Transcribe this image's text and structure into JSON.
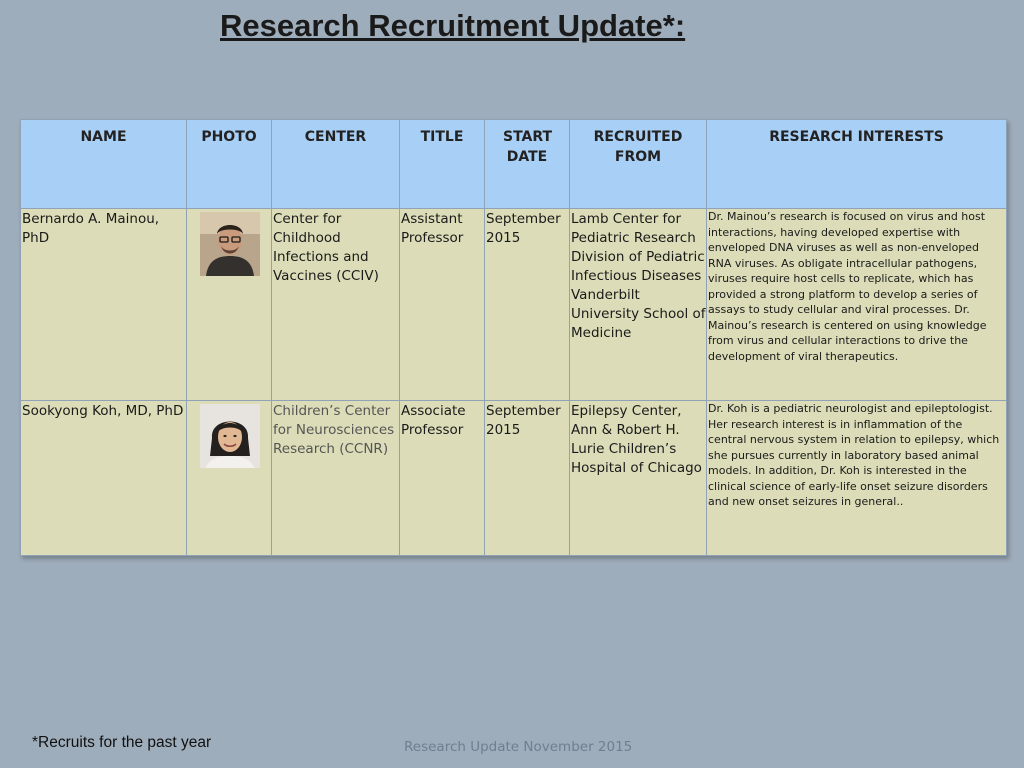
{
  "page_title": "Research Recruitment Update*:",
  "table": {
    "headers": {
      "name": "NAME",
      "photo": "PHOTO",
      "center": "CENTER",
      "title": "TITLE",
      "start_date": "START DATE",
      "recruited_from": "RECRUITED FROM",
      "research_interests": "RESEARCH INTERESTS"
    },
    "rows": [
      {
        "name": "Bernardo A. Mainou, PhD",
        "photo_icon": "person-photo-icon",
        "center": "Center for Childhood Infections and Vaccines (CCIV)",
        "title": "Assistant Professor",
        "start_date": "September 2015",
        "recruited_from": "Lamb Center for Pediatric Research Division of Pediatric Infectious Diseases Vanderbilt University School of Medicine",
        "research_interests": "Dr. Mainou’s research is focused on virus and host interactions, having developed expertise with enveloped DNA viruses as well as non-enveloped RNA viruses. As obligate intracellular pathogens, viruses require host cells to replicate, which has provided a strong platform to develop a series of assays to study cellular and viral processes. Dr. Mainou’s research is centered on using knowledge from virus and cellular interactions to drive the development of viral therapeutics."
      },
      {
        "name": "Sookyong Koh, MD, PhD",
        "photo_icon": "person-photo-icon",
        "center": "Children’s Center for Neurosciences Research (CCNR)",
        "title": "Associate Professor",
        "start_date": "September 2015",
        "recruited_from": "Epilepsy Center, Ann & Robert H. Lurie Children’s Hospital of Chicago",
        "research_interests": "Dr. Koh is a pediatric neurologist and epileptologist. Her research interest is in inflammation of the central nervous system in relation to epilepsy, which she pursues currently in laboratory based animal models. In addition, Dr. Koh is interested in the clinical science of early-life onset seizure disorders and new onset seizures in general.."
      }
    ]
  },
  "footnote": "*Recruits for the past year",
  "footer": "Research Update November 2015",
  "colors": {
    "background": "#9eadbb",
    "header_fill": "#a8cff5",
    "cell_fill": "#dcddb8"
  }
}
